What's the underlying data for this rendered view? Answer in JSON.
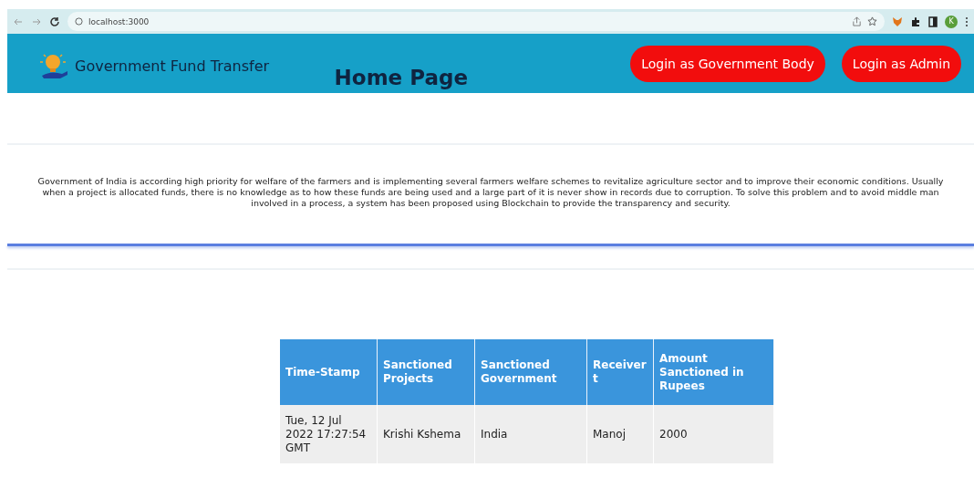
{
  "browser": {
    "url": "localhost:3000",
    "profile_initial": "K"
  },
  "header": {
    "brand": "Government Fund Transfer",
    "title": "Home Page",
    "buttons": [
      "Login as Government Body",
      "Login as Admin"
    ]
  },
  "intro": "Government of India is according high priority for welfare of the farmers and is implementing several farmers welfare schemes to revitalize agriculture sector and to improve their economic conditions. Usually when a project is allocated funds, there is no knowledge as to how these funds are being used and a large part of it is never show in records due to corruption. To solve this problem and to avoid middle man involved in a process, a system has been proposed using Blockchain to provide the transparency and security.",
  "table": {
    "columns": [
      "Time-Stamp",
      "Sanctioned Projects",
      "Sanctioned Government",
      "Receivert",
      "Amount Sanctioned in Rupees"
    ],
    "rows": [
      [
        "Tue, 12 Jul 2022 17:27:54 GMT",
        "Krishi Kshema",
        "India",
        "Manoj",
        "2000"
      ]
    ]
  }
}
